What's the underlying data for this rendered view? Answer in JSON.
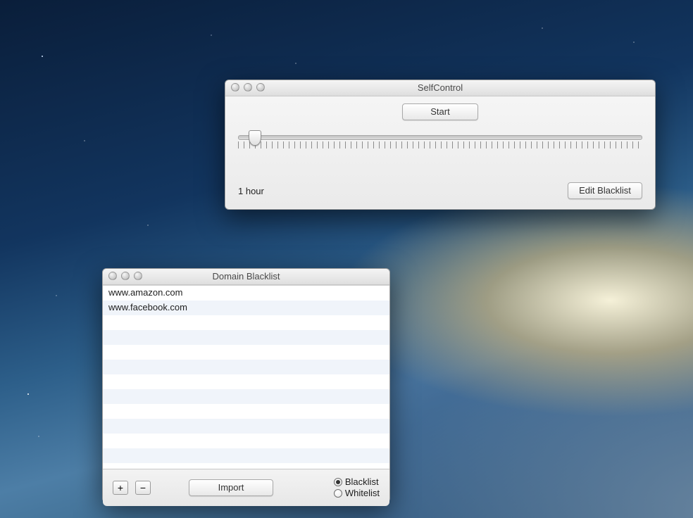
{
  "selfcontrol": {
    "title": "SelfControl",
    "start_label": "Start",
    "edit_label": "Edit Blacklist",
    "duration_label": "1 hour",
    "slider_percent": 4
  },
  "blacklist": {
    "title": "Domain Blacklist",
    "domains": [
      "www.amazon.com",
      "www.facebook.com"
    ],
    "visible_rows": 13,
    "add_label": "+",
    "remove_label": "−",
    "import_label": "Import",
    "mode_options": {
      "blacklist": "Blacklist",
      "whitelist": "Whitelist"
    },
    "mode_selected": "blacklist"
  }
}
